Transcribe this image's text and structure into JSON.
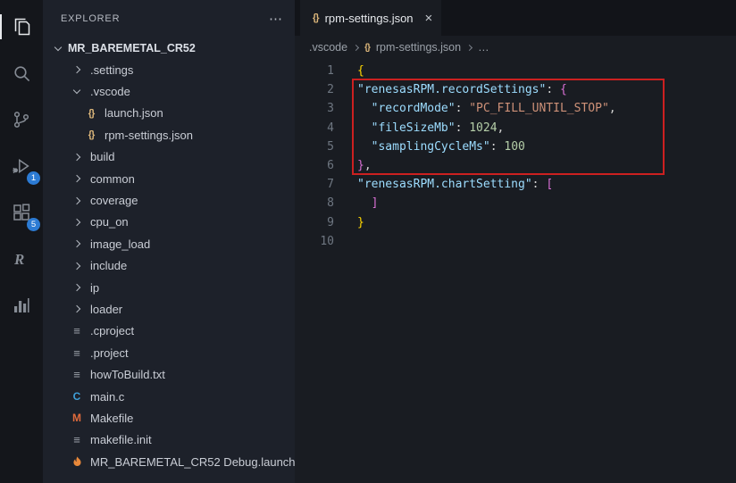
{
  "icon_glyphs": {
    "json-icon": "{}",
    "file-icon": "≡",
    "c-icon": "C",
    "makefile-icon": "M",
    "more-icon": "⋯",
    "close-icon": "×"
  },
  "colors": {
    "accent_badge": "#2c7bd4",
    "annotation_red": "#cc2020",
    "json_key": "#9cdcfe",
    "json_string": "#ce9178",
    "json_number": "#b5cea8",
    "bracket_outer": "#ffd700",
    "bracket_inner": "#da70d6"
  },
  "activity_bar": {
    "items": [
      {
        "icon": "files-explorer-icon"
      },
      {
        "icon": "search-icon"
      },
      {
        "icon": "source-control-icon"
      },
      {
        "icon": "run-debug-icon",
        "badge": "1"
      },
      {
        "icon": "extensions-icon",
        "badge": "5"
      },
      {
        "icon": "renesas-icon"
      },
      {
        "icon": "chart-icon"
      }
    ]
  },
  "sidebar": {
    "title": "EXPLORER",
    "more_label": "⋯",
    "workspace": "MR_BAREMETAL_CR52",
    "items": [
      {
        "icon": "chevron-right-icon",
        "label": ".settings",
        "indent": 0
      },
      {
        "icon": "chevron-down-icon",
        "label": ".vscode",
        "indent": 0
      },
      {
        "icon": "json-icon",
        "label": "launch.json",
        "indent": 1
      },
      {
        "icon": "json-icon",
        "label": "rpm-settings.json",
        "indent": 1
      },
      {
        "icon": "chevron-right-icon",
        "label": "build",
        "indent": 0
      },
      {
        "icon": "chevron-right-icon",
        "label": "common",
        "indent": 0
      },
      {
        "icon": "chevron-right-icon",
        "label": "coverage",
        "indent": 0
      },
      {
        "icon": "chevron-right-icon",
        "label": "cpu_on",
        "indent": 0
      },
      {
        "icon": "chevron-right-icon",
        "label": "image_load",
        "indent": 0
      },
      {
        "icon": "chevron-right-icon",
        "label": "include",
        "indent": 0
      },
      {
        "icon": "chevron-right-icon",
        "label": "ip",
        "indent": 0
      },
      {
        "icon": "chevron-right-icon",
        "label": "loader",
        "indent": 0
      },
      {
        "icon": "file-icon",
        "label": ".cproject",
        "indent": 0
      },
      {
        "icon": "file-icon",
        "label": ".project",
        "indent": 0
      },
      {
        "icon": "file-icon",
        "label": "howToBuild.txt",
        "indent": 0
      },
      {
        "icon": "c-icon",
        "label": "main.c",
        "indent": 0
      },
      {
        "icon": "makefile-icon",
        "label": "Makefile",
        "indent": 0
      },
      {
        "icon": "file-icon",
        "label": "makefile.init",
        "indent": 0
      },
      {
        "icon": "launch-icon",
        "label": "MR_BAREMETAL_CR52 Debug.launch",
        "indent": 0
      }
    ]
  },
  "editor": {
    "tab": {
      "label": "rpm-settings.json",
      "close": "×"
    },
    "breadcrumb": {
      "folder": ".vscode",
      "file": "rpm-settings.json",
      "more": "…"
    },
    "lines": [
      {
        "no": "1",
        "tokens": [
          {
            "t": "{",
            "c": "b0"
          }
        ]
      },
      {
        "no": "2",
        "tokens": [
          {
            "t": "\"renesasRPM.recordSettings\"",
            "c": "key"
          },
          {
            "t": ": ",
            "c": "punc"
          },
          {
            "t": "{",
            "c": "b1"
          }
        ]
      },
      {
        "no": "3",
        "tokens": [
          {
            "t": "  \"recordMode\"",
            "c": "key"
          },
          {
            "t": ": ",
            "c": "punc"
          },
          {
            "t": "\"PC_FILL_UNTIL_STOP\"",
            "c": "str"
          },
          {
            "t": ",",
            "c": "punc"
          }
        ]
      },
      {
        "no": "4",
        "tokens": [
          {
            "t": "  \"fileSizeMb\"",
            "c": "key"
          },
          {
            "t": ": ",
            "c": "punc"
          },
          {
            "t": "1024",
            "c": "num"
          },
          {
            "t": ",",
            "c": "punc"
          }
        ]
      },
      {
        "no": "5",
        "tokens": [
          {
            "t": "  \"samplingCycleMs\"",
            "c": "key"
          },
          {
            "t": ": ",
            "c": "punc"
          },
          {
            "t": "100",
            "c": "num"
          }
        ]
      },
      {
        "no": "6",
        "tokens": [
          {
            "t": "}",
            "c": "b1"
          },
          {
            "t": ",",
            "c": "punc"
          }
        ]
      },
      {
        "no": "7",
        "tokens": [
          {
            "t": "\"renesasRPM.chartSetting\"",
            "c": "key"
          },
          {
            "t": ": ",
            "c": "punc"
          },
          {
            "t": "[",
            "c": "b1"
          }
        ]
      },
      {
        "no": "8",
        "tokens": [
          {
            "t": "  ]",
            "c": "b1"
          }
        ]
      },
      {
        "no": "9",
        "tokens": [
          {
            "t": "}",
            "c": "b0"
          }
        ]
      },
      {
        "no": "10",
        "tokens": []
      }
    ]
  }
}
